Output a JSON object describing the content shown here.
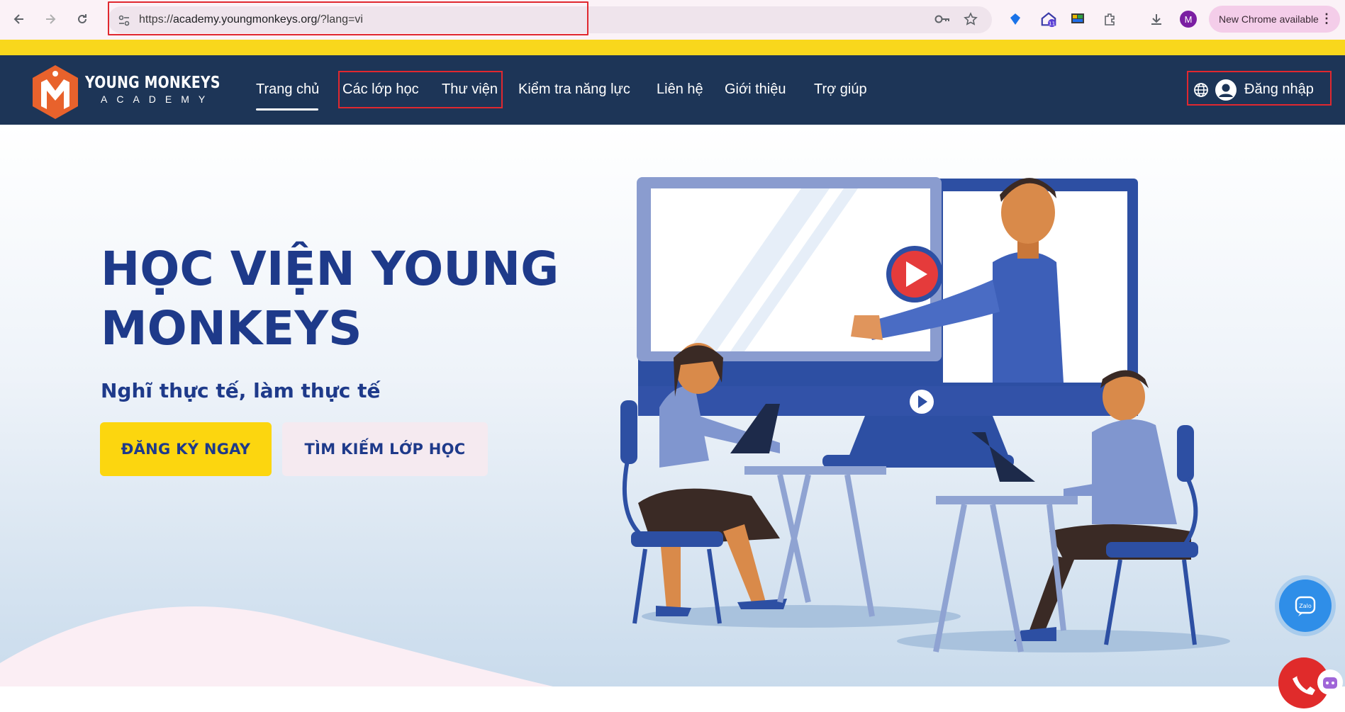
{
  "browser": {
    "url_prefix": "https://",
    "url_host": "academy.youngmonkeys.org",
    "url_path": "/?lang=vi",
    "update_label": "New Chrome available",
    "profile_initial": "M",
    "menu_glyph": "⋮",
    "icons": [
      "back-icon",
      "forward-icon",
      "reload-icon",
      "tune-icon",
      "key-icon",
      "star-icon",
      "extension-icon",
      "download-icon"
    ]
  },
  "site": {
    "logo_line1": "YOUNG MONKEYS",
    "logo_line2": "ACADEMY",
    "menu": [
      {
        "label": "Trang chủ",
        "active": true
      },
      {
        "label": "Các lớp học"
      },
      {
        "label": "Thư viện"
      },
      {
        "label": "Kiểm tra năng lực"
      },
      {
        "label": "Liên hệ"
      },
      {
        "label": "Giới thiệu"
      },
      {
        "label": "Trợ giúp"
      }
    ],
    "login_label": "Đăng nhập"
  },
  "hero": {
    "title_line1": "HỌC VIỆN YOUNG",
    "title_line2": "MONKEYS",
    "subtitle": "Nghĩ thực tế, làm thực tế",
    "cta_primary": "ĐĂNG KÝ NGAY",
    "cta_secondary": "TÌM KIẾM LỚP HỌC"
  },
  "widgets": {
    "zalo_label": "Zalo"
  },
  "colors": {
    "nav_bg": "#1d3557",
    "accent_yellow": "#fcd60f",
    "brand_blue": "#1e3a8a",
    "highlight_red": "#e0282f",
    "logo_orange": "#e8622c"
  }
}
